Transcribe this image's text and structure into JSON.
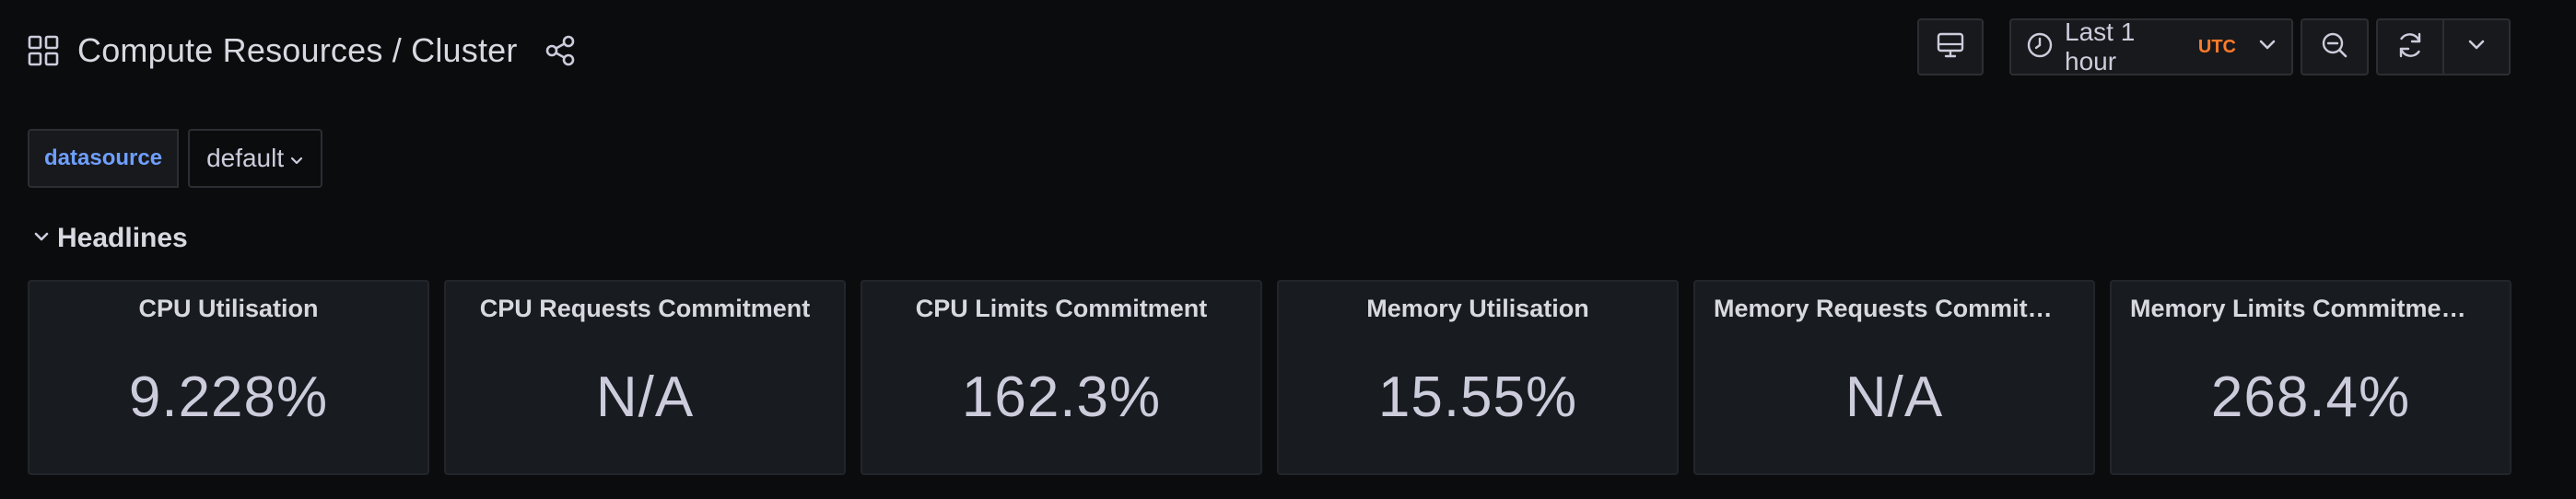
{
  "header": {
    "title": "Compute Resources / Cluster",
    "icons": {
      "dashboard": "grid-icon",
      "share": "share-icon"
    }
  },
  "toolbar": {
    "tv_icon": "tv-mode-icon",
    "time_range": "Last 1 hour",
    "timezone": "UTC",
    "timezone_color": "#ff7b29",
    "zoom_icon": "zoom-out-icon",
    "refresh_icon": "refresh-icon",
    "refresh_menu_icon": "chevron-down-icon"
  },
  "variables": {
    "label": "datasource",
    "selected": "default"
  },
  "row": {
    "title": "Headlines"
  },
  "panels": [
    {
      "title": "CPU Utilisation",
      "value": "9.228%"
    },
    {
      "title": "CPU Requests Commitment",
      "value": "N/A"
    },
    {
      "title": "CPU Limits Commitment",
      "value": "162.3%"
    },
    {
      "title": "Memory Utilisation",
      "value": "15.55%"
    },
    {
      "title": "Memory Requests Commit…",
      "value": "N/A"
    },
    {
      "title": "Memory Limits Commitme…",
      "value": "268.4%"
    }
  ]
}
